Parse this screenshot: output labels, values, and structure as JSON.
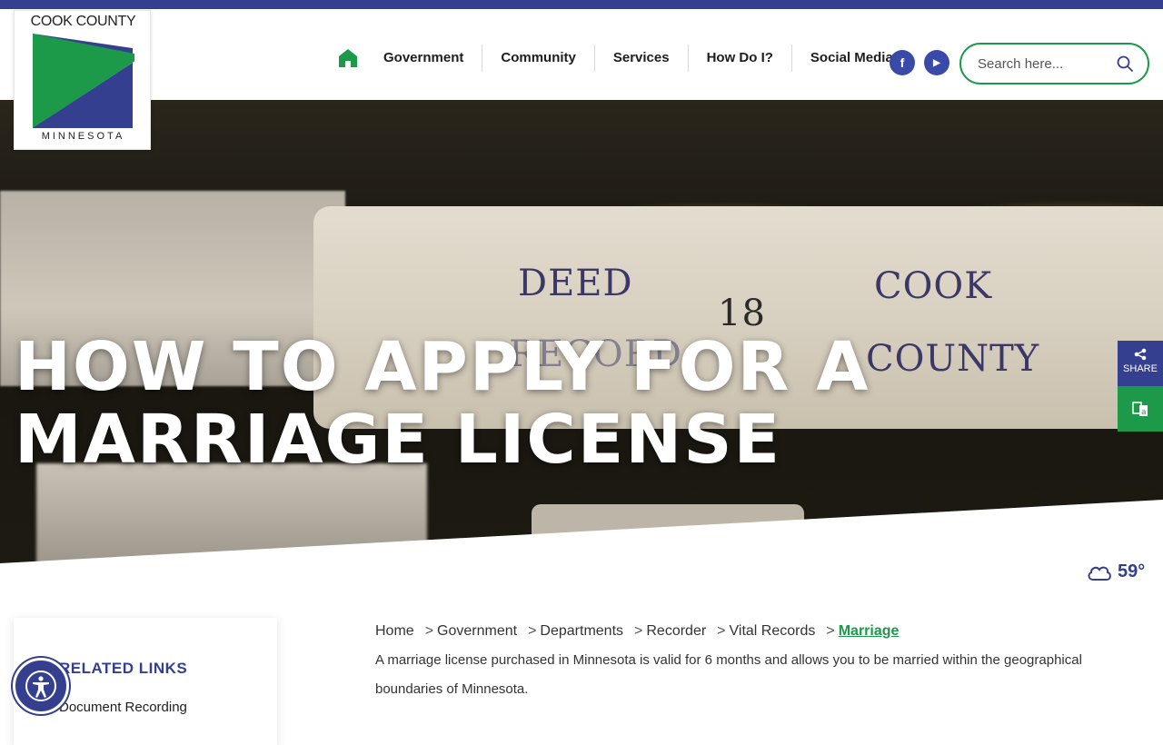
{
  "logo": {
    "top_text": "COOK COUNTY",
    "bottom_text": "MINNESOTA",
    "colors": {
      "green": "#1c9a4a",
      "blue": "#34408f"
    }
  },
  "nav": {
    "home_icon": "home-icon",
    "items": [
      {
        "label": "Government"
      },
      {
        "label": "Community"
      },
      {
        "label": "Services"
      },
      {
        "label": "How Do I?"
      },
      {
        "label": "Social Media"
      }
    ],
    "social": [
      {
        "icon": "facebook-icon",
        "glyph": "f"
      },
      {
        "icon": "youtube-icon",
        "glyph": "▶"
      }
    ]
  },
  "search": {
    "placeholder": "Search here...",
    "icon": "search-icon"
  },
  "hero": {
    "title": "HOW TO APPLY FOR A MARRIAGE LICENSE",
    "photo": {
      "spine_left": "DEED",
      "spine_left2": "RECORD",
      "spine_number": "18",
      "spine_right": "COOK",
      "spine_right2": "COUNTY"
    }
  },
  "side_tools": {
    "share_label": "SHARE",
    "share_icon": "share-icon",
    "translate_icon": "translate-icon"
  },
  "weather": {
    "icon": "cloud-icon",
    "temp": "59°"
  },
  "related": {
    "title": "RELATED LINKS",
    "links": [
      {
        "label": "Document Recording"
      }
    ]
  },
  "accessibility": {
    "icon": "accessibility-icon"
  },
  "breadcrumb": {
    "items": [
      {
        "label": "Home"
      },
      {
        "label": "Government"
      },
      {
        "label": "Departments"
      },
      {
        "label": "Recorder"
      },
      {
        "label": "Vital Records"
      },
      {
        "label": "Marriage"
      }
    ],
    "separator": ">"
  },
  "intro": "A marriage license purchased in Minnesota is valid for 6 months and allows you to be married within the geographical boundaries of Minnesota.",
  "colors": {
    "brand_blue": "#34408f",
    "brand_green": "#1c9a4a"
  }
}
